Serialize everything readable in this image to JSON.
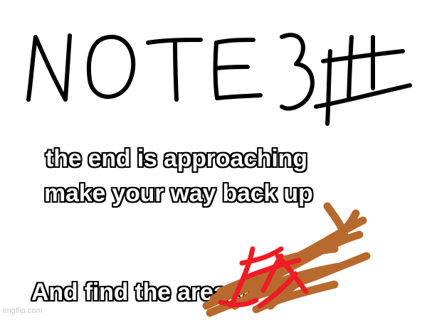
{
  "title": {
    "handwritten_text": "NOTE 3#"
  },
  "caption": {
    "line_1": "the end is approaching",
    "line_2": "make your way back up",
    "line_3": "And find the        area :)"
  },
  "scribble": {
    "colors": [
      "#b86a2e",
      "#ee1c25"
    ]
  },
  "watermark": {
    "text": "imgflip.com"
  },
  "colors": {
    "background": "#ffffff",
    "ink": "#000000",
    "caption_fill": "#ffffff",
    "caption_outline": "#000000"
  }
}
